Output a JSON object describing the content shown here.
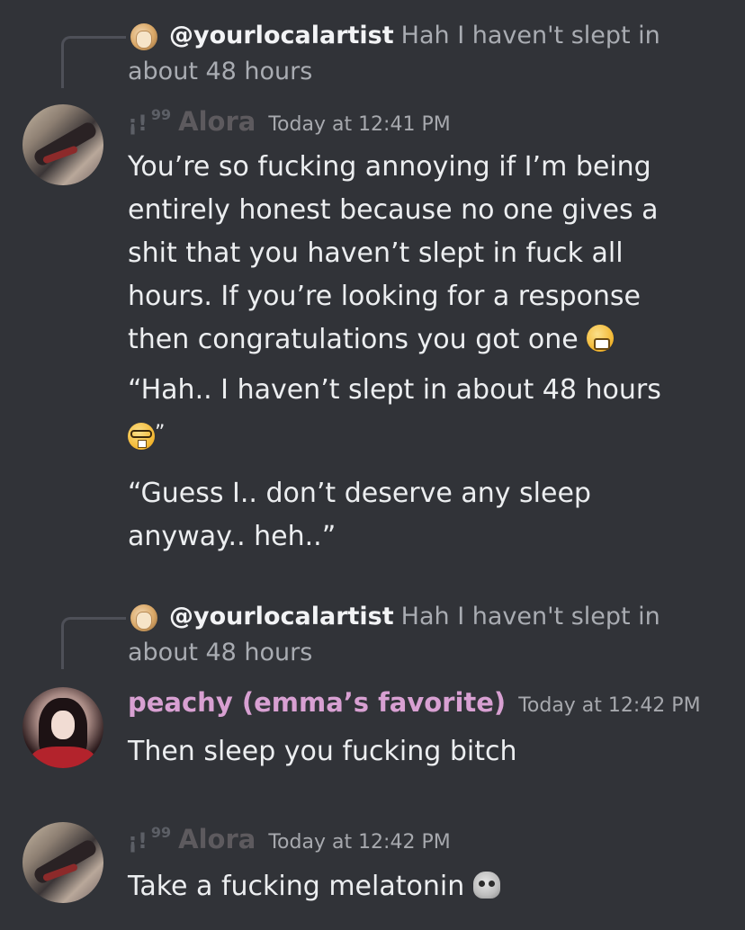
{
  "colors": {
    "background": "#313338",
    "text": "#eceef0",
    "muted": "#a9acb2",
    "peachy_name": "#d8a0d2",
    "alora_name": "#5d5a5e"
  },
  "messages": [
    {
      "reply": {
        "username": "@yourlocalartist",
        "text": "Hah I haven't slept in about 48 hours",
        "avatar_icon": "hand-avatar-icon"
      },
      "tag": "¡!",
      "tag_quote": "99",
      "username": "Alora",
      "timestamp": "Today at 12:41 PM",
      "paragraphs": [
        "You’re so fucking annoying if I’m being entirely honest because no one gives a shit that you haven’t slept in fuck all hours. If you’re looking for a response then congratulations you got one",
        "“Hah.. I haven’t slept in about 48 hours",
        "”",
        "“Guess I.. don’t deserve any sleep anyway.. heh..”"
      ],
      "emojis": [
        "grimacing-emoji-icon",
        "nerd-face-emoji-icon"
      ]
    },
    {
      "reply": {
        "username": "@yourlocalartist",
        "text": "Hah I haven't slept in about 48 hours",
        "avatar_icon": "hand-avatar-icon"
      },
      "username": "peachy (emma’s favorite)",
      "timestamp": "Today at 12:42 PM",
      "text": "Then sleep you fucking bitch"
    },
    {
      "tag": "¡!",
      "tag_quote": "99",
      "username": "Alora",
      "timestamp": "Today at 12:42 PM",
      "text": "Take a fucking melatonin",
      "emojis": [
        "skull-emoji-icon"
      ]
    }
  ]
}
